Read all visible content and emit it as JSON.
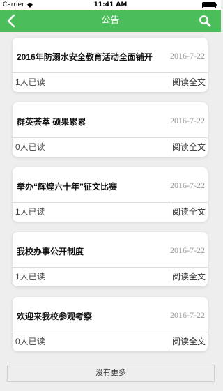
{
  "status": {
    "carrier": "Carrier",
    "time": "11:41 AM"
  },
  "header": {
    "title": "公告",
    "back_icon": "chevron-left-icon",
    "search_icon": "search-icon",
    "color": "#4cbd5b"
  },
  "notices": [
    {
      "title": "2016年防溺水安全教育活动全面铺开",
      "date": "2016-7-22",
      "reads": "1人已读",
      "more": "阅读全文"
    },
    {
      "title": "群英荟萃 硕果累累",
      "date": "2016-7-22",
      "reads": "0人已读",
      "more": "阅读全文"
    },
    {
      "title": "举办“辉煌六十年”征文比赛",
      "date": "2016-7-22",
      "reads": "1人已读",
      "more": "阅读全文"
    },
    {
      "title": "我校办事公开制度",
      "date": "2016-7-22",
      "reads": "1人已读",
      "more": "阅读全文"
    },
    {
      "title": "欢迎来我校参观考察",
      "date": "2016-7-22",
      "reads": "0人已读",
      "more": "阅读全文"
    }
  ],
  "footer": {
    "no_more": "没有更多"
  }
}
